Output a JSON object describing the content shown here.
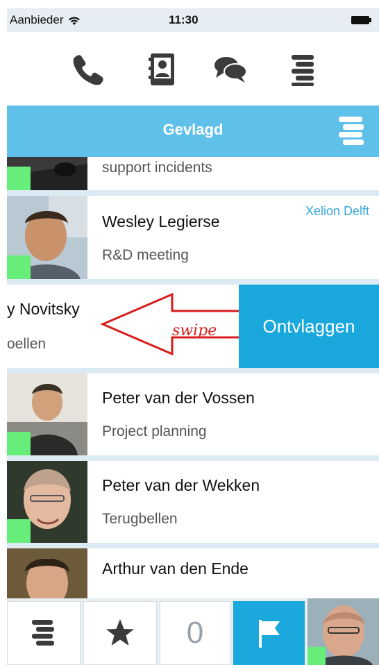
{
  "status_bar": {
    "carrier": "Aanbieder",
    "time": "11:30"
  },
  "toolbar": {
    "icons": [
      "phone-icon",
      "contacts-icon",
      "chat-icon",
      "menu-icon"
    ]
  },
  "header": {
    "title": "Gevlagd"
  },
  "contacts": [
    {
      "name": "",
      "subject": "support incidents",
      "company": ""
    },
    {
      "name": "Wesley Legierse",
      "subject": "R&D meeting",
      "company": "Xelion Delft"
    },
    {
      "name": "y Novitsky",
      "subject": "oellen",
      "company": ""
    },
    {
      "name": "Peter van der Vossen",
      "subject": "Project planning",
      "company": ""
    },
    {
      "name": "Peter van der Wekken",
      "subject": "Terugbellen",
      "company": ""
    },
    {
      "name": "Arthur van den Ende",
      "subject": "",
      "company": ""
    }
  ],
  "swipe": {
    "action_label": "Ontvlaggen",
    "hint": "swipe"
  },
  "tabbar": {
    "count": "0"
  },
  "colors": {
    "accent": "#5fc0ea",
    "active_tab": "#1aa8dd",
    "online": "#67ee7a",
    "swipe_hint": "#d81c1c"
  }
}
